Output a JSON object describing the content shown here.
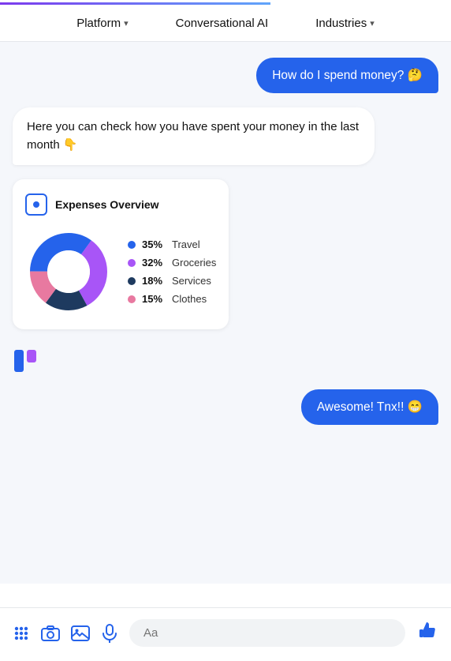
{
  "progress": {
    "width": "60%"
  },
  "nav": {
    "items": [
      {
        "label": "Platform",
        "hasChevron": true
      },
      {
        "label": "Conversational AI",
        "hasChevron": false
      },
      {
        "label": "Industries",
        "hasChevron": true
      }
    ]
  },
  "messages": [
    {
      "type": "user",
      "text": "How do I spend money? 🤔"
    },
    {
      "type": "bot",
      "text": "Here you can check how you have spent your money in the last month 👇"
    }
  ],
  "chart": {
    "title": "Expenses Overview",
    "segments": [
      {
        "label": "Travel",
        "pct": "35%",
        "color": "#2563eb"
      },
      {
        "label": "Groceries",
        "pct": "32%",
        "color": "#a855f7"
      },
      {
        "label": "Services",
        "pct": "18%",
        "color": "#1e3a5f"
      },
      {
        "label": "Clothes",
        "pct": "15%",
        "color": "#e879a0"
      }
    ]
  },
  "response_msg": {
    "text": "Awesome! Tnx!! 😁"
  },
  "toolbar": {
    "input_placeholder": "Aa"
  }
}
